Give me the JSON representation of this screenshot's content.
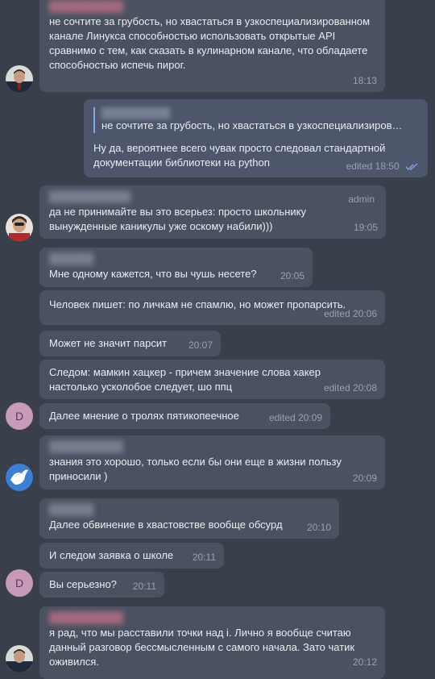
{
  "messages": [
    {
      "text": "не сочтите за грубость, но хвастаться в узкоспециализированном канале Линукса способностью использовать открытые API сравнимо с тем, как сказать в кулинарном канале, что обладаете способностью испечь пирог.",
      "time": "18:13"
    },
    {
      "reply_text": "не сочтите за грубость, но хвастаться в узкоспециализиров…",
      "text": "Ну да, вероятнее всего чувак просто следовал стандартной документации библиотеки на python",
      "time": "edited 18:50"
    },
    {
      "role": "admin",
      "text": "да не принимайте вы это всерьез: просто школьнику вынужденные каникулы уже оскому набили)))",
      "time": "19:05"
    },
    {
      "text": "Мне одному кажется, что вы чушь несете?",
      "time": "20:05"
    },
    {
      "text": "Человек пишет: по личкам не спамлю, но может пропарсить.",
      "time": "edited 20:06"
    },
    {
      "text": "Может не значит парсит",
      "time": "20:07"
    },
    {
      "text": "Следом: мамкин хацкер - причем значение слова хакер настолько усколобое следует, шо ппц",
      "time": "edited 20:08"
    },
    {
      "text": "Далее мнение о тролях пятикопеечное",
      "time": "edited 20:09"
    },
    {
      "text": "знания это хорошо, только если бы они еще в жизни пользу приносили )",
      "time": "20:09"
    },
    {
      "text": "Далее обвинение в хвастовстве вообще обсурд",
      "time": "20:10"
    },
    {
      "text": "И следом заявка о школе",
      "time": "20:11"
    },
    {
      "text": "Вы серьезно?",
      "time": "20:11"
    },
    {
      "text": "я рад, что мы расставили точки над i. Лично я вообще считаю данный разговор бессмысленным с самого начала. Зато чатик оживился.",
      "time": "20:12"
    }
  ],
  "avatars": {
    "letter_d": "D"
  },
  "colors": {
    "background": "#3a3f4c",
    "bubble": "#4a5161",
    "bubble_outgoing": "#4d566a",
    "meta_text": "#98a1b3",
    "reply_bar": "#7fa8e0",
    "read_ticks": "#7fa8e0",
    "letter_avatar": "#c79ab9"
  }
}
